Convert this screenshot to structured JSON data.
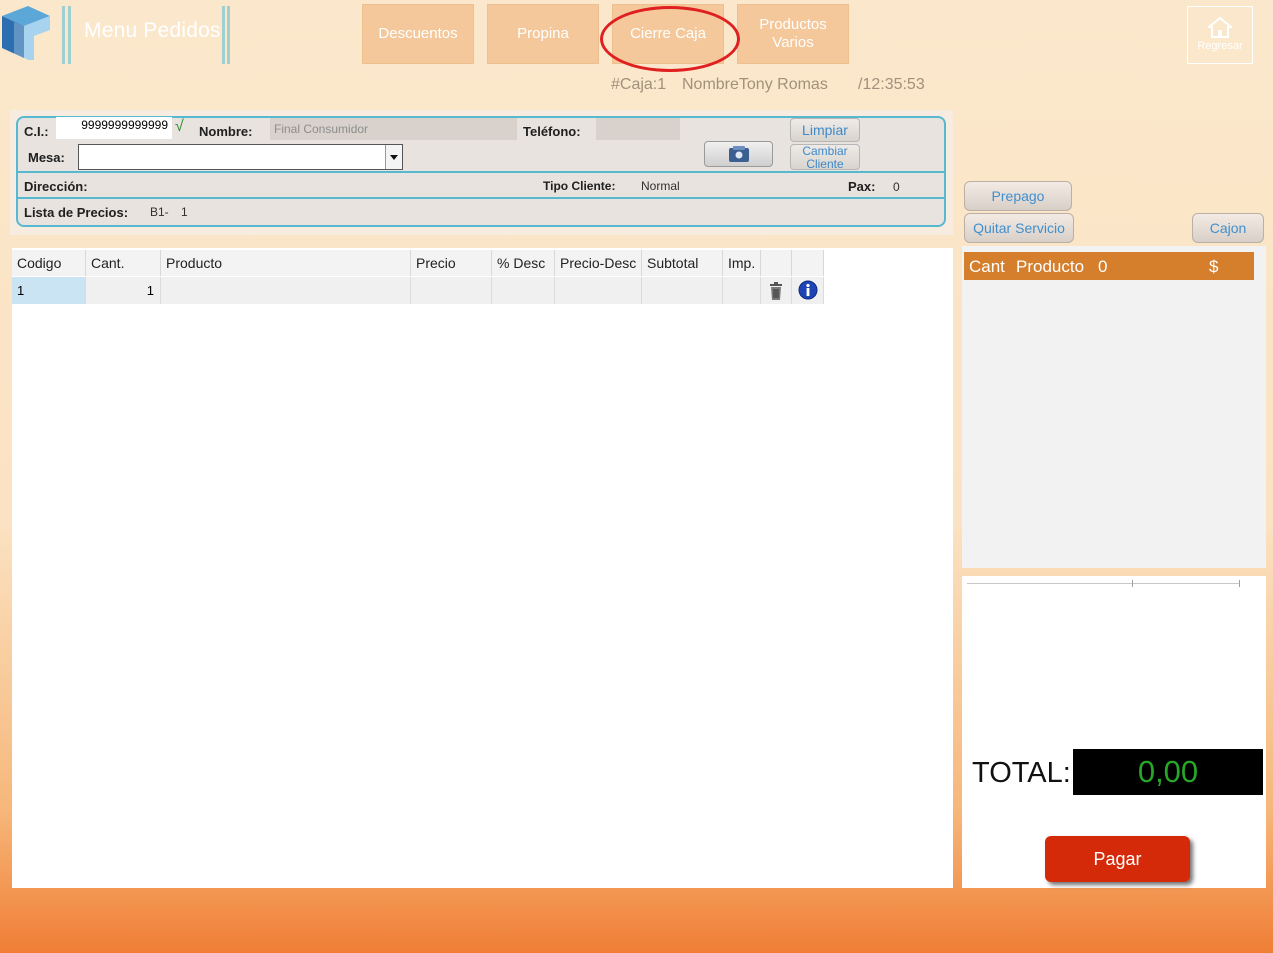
{
  "app": {
    "title": "Menu Pedidos"
  },
  "nav": {
    "descuentos": "Descuentos",
    "propina": "Propina",
    "cierre_caja": "Cierre Caja",
    "productos_varios": "Productos Varios",
    "regresar": "Regresar"
  },
  "status": {
    "caja": "#Caja:1",
    "nombre": "NombreTony Romas",
    "time": "/12:35:53"
  },
  "client": {
    "ci_label": "C.I.:",
    "ci_value": "9999999999999",
    "check": "√",
    "nombre_label": "Nombre:",
    "nombre_value": "Final Consumidor",
    "telefono_label": "Teléfono:",
    "mesa_label": "Mesa:",
    "direccion_label": "Dirección:",
    "tipo_cliente_label": "Tipo Cliente:",
    "tipo_cliente_value": "Normal",
    "pax_label": "Pax:",
    "pax_value": "0",
    "lista_label": "Lista de Precios:",
    "lista_code": "B1-",
    "lista_value": "1",
    "limpiar": "Limpiar",
    "cambiar_cliente": "Cambiar Cliente"
  },
  "table": {
    "headers": [
      "Codigo",
      "Cant.",
      "Producto",
      "Precio",
      "% Desc",
      "Precio-Desc",
      "Subtotal",
      "Imp."
    ],
    "rows": [
      {
        "codigo": "1",
        "cant": "1"
      }
    ]
  },
  "right": {
    "prepago": "Prepago",
    "quitar_servicio": "Quitar Servicio",
    "cajon": "Cajon",
    "order_cant": "Cant",
    "order_producto": "Producto",
    "order_count": "0",
    "order_currency": "$",
    "total_label": "TOTAL:",
    "total_value": "0,00",
    "pagar": "Pagar"
  },
  "colors": {
    "accent_teal": "#57b9cf",
    "order_header": "#d57f2d",
    "pay_button": "#d42a0a",
    "total_green": "#27a627",
    "highlight": "#e02020"
  }
}
